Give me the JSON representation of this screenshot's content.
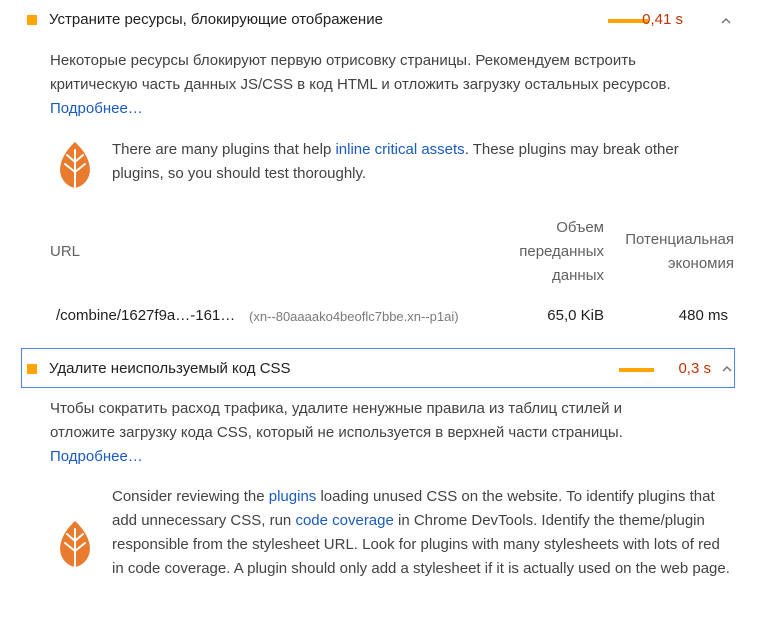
{
  "audits": [
    {
      "title": "Устраните ресурсы, блокирующие отображение",
      "value": "0,41 s",
      "description": "Некоторые ресурсы блокируют первую отрисовку страницы. Рекомендуем встроить критическую часть данных JS/CSS в код HTML и отложить загрузку остальных ресурсов.",
      "learn_more": "Подробнее…",
      "stack_pack": {
        "before": "There are many plugins that help ",
        "link": "inline critical assets",
        "after": ". These plugins may break other plugins, so you should test thoroughly."
      },
      "table": {
        "col_url": "URL",
        "col_transfer": [
          "Объем",
          "переданных",
          "данных"
        ],
        "col_savings": [
          "Потенциальная",
          "экономия"
        ],
        "rows": [
          {
            "url": "/combine/1627f9a…-161…",
            "host": "(xn--80aaaako4beoflc7bbe.xn--p1ai)",
            "transfer": "65,0 KiB",
            "savings": "480 ms"
          }
        ]
      }
    },
    {
      "title": "Удалите неиспользуемый код CSS",
      "value": "0,3 s",
      "description": "Чтобы сократить расход трафика, удалите ненужные правила из таблиц стилей и отложите загрузку кода CSS, который не используется в верхней части страницы.",
      "learn_more": "Подробнее…",
      "stack_pack": {
        "t1": "Consider reviewing the ",
        "link1": "plugins",
        "t2": " loading unused CSS on the website. To identify plugins that add unnecessary CSS, run ",
        "link2": "code coverage",
        "t3": " in Chrome DevTools. Identify the theme/plugin responsible from the stylesheet URL. Look for plugins with many stylesheets with lots of red in code coverage. A plugin should only add a stylesheet if it is actually used on the web page."
      }
    }
  ],
  "colors": {
    "average": "#ffa400",
    "value_text": "#c33300",
    "link": "#1a5bbf",
    "focus_border": "#4285f4",
    "leaf": "#e87b2d"
  },
  "icons": {
    "status": "square-average-icon",
    "toggle": "chevron-up-icon",
    "stack_pack": "leaf-icon"
  }
}
